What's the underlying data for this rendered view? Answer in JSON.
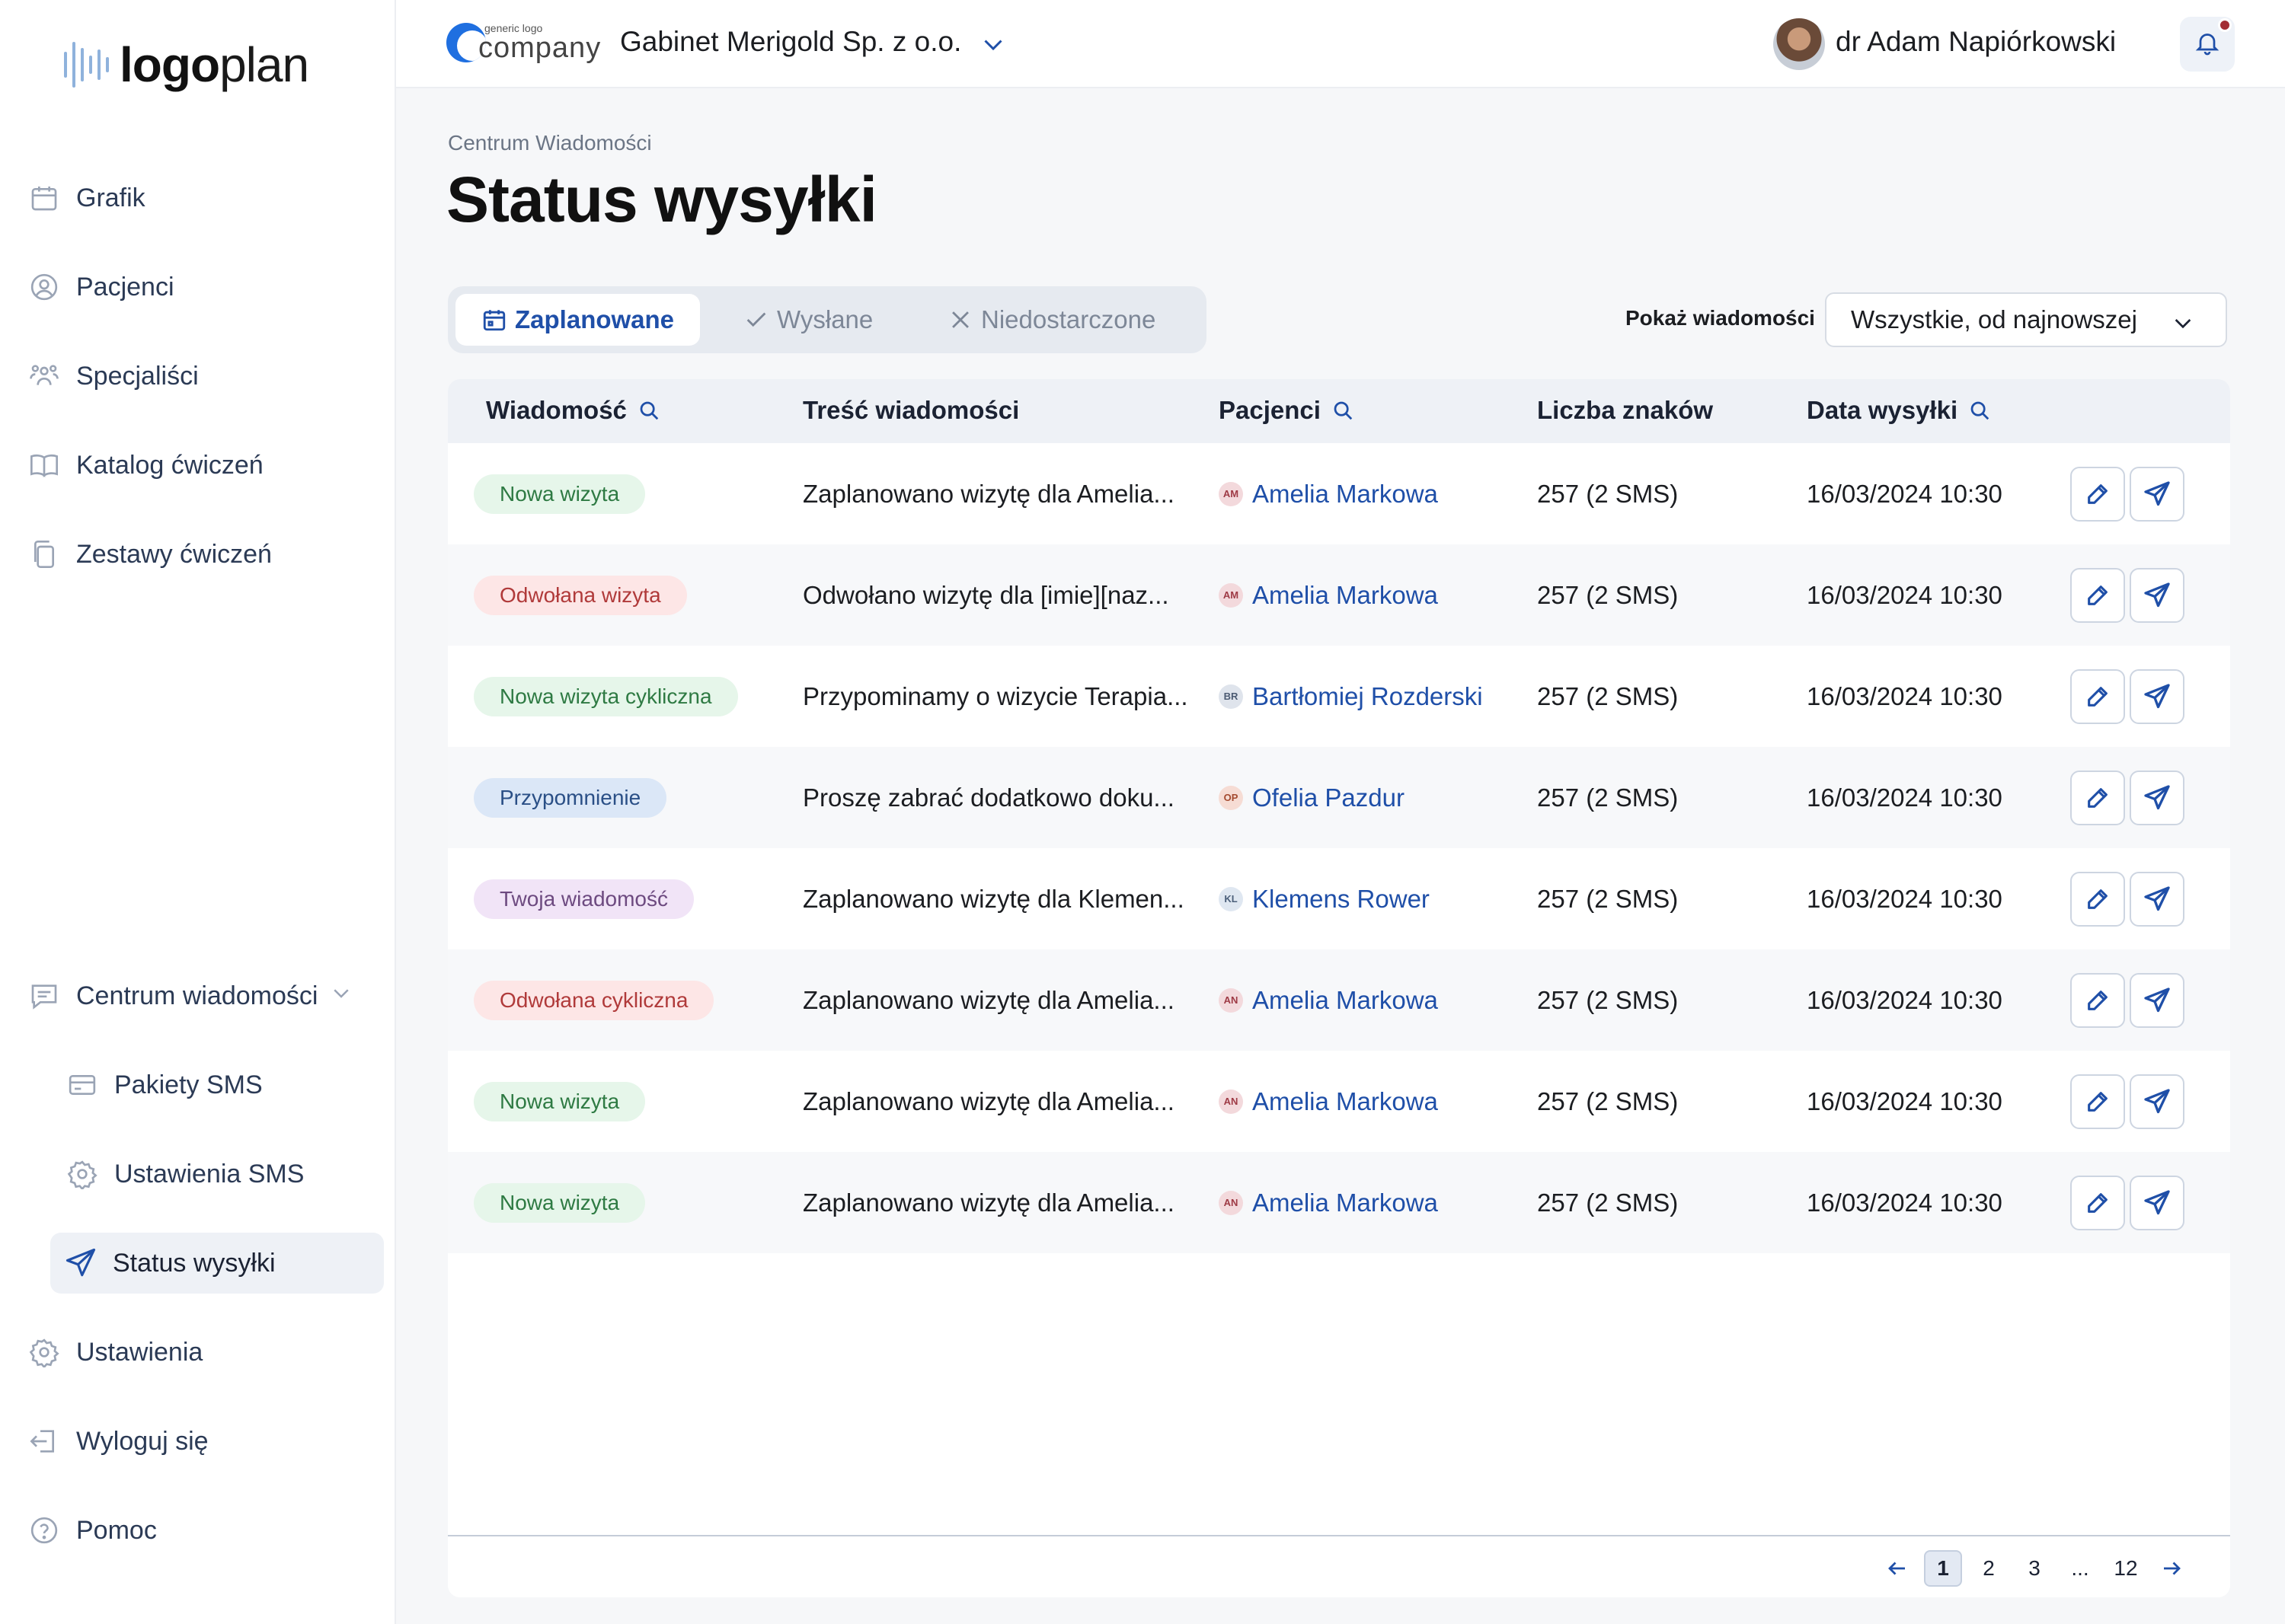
{
  "brand": {
    "logo_bold": "logo",
    "logo_light": "plan",
    "accent": "#1f4fa8"
  },
  "company": {
    "logo_small": "generic logo",
    "logo_big": "company",
    "clinic_name": "Gabinet Merigold Sp. z o.o."
  },
  "user": {
    "name": "dr Adam Napiórkowski"
  },
  "sidebar": {
    "items": [
      {
        "label": "Grafik",
        "icon": "calendar-icon"
      },
      {
        "label": "Pacjenci",
        "icon": "user-circle-icon"
      },
      {
        "label": "Specjaliści",
        "icon": "users-icon"
      },
      {
        "label": "Katalog ćwiczeń",
        "icon": "book-icon"
      },
      {
        "label": "Zestawy ćwiczeń",
        "icon": "copy-icon"
      }
    ],
    "messages_center": "Centrum wiadomości",
    "sub_items": [
      {
        "label": "Pakiety SMS",
        "icon": "card-icon"
      },
      {
        "label": "Ustawienia SMS",
        "icon": "gear-icon"
      },
      {
        "label": "Status wysyłki",
        "icon": "send-icon"
      }
    ],
    "bottom_items": [
      {
        "label": "Ustawienia",
        "icon": "gear-icon"
      },
      {
        "label": "Wyloguj się",
        "icon": "logout-icon"
      },
      {
        "label": "Pomoc",
        "icon": "help-icon"
      }
    ]
  },
  "page": {
    "breadcrumb": "Centrum Wiadomości",
    "title": "Status wysyłki"
  },
  "tabs": [
    {
      "label": "Zaplanowane",
      "active": true
    },
    {
      "label": "Wysłane",
      "active": false
    },
    {
      "label": "Niedostarczone",
      "active": false
    }
  ],
  "filter": {
    "label": "Pokaż wiadomości",
    "value": "Wszystkie, od najnowszej"
  },
  "table": {
    "headers": [
      "Wiadomość",
      "Treść wiadomości",
      "Pacjenci",
      "Liczba znaków",
      "Data wysyłki"
    ],
    "rows": [
      {
        "type": "Nowa wizyta",
        "badge_bg": "#e6f6ea",
        "badge_fg": "#2e7a43",
        "content": "Zaplanowano wizytę dla Amelia...",
        "initials": "AM",
        "init_bg": "#f3d9dc",
        "init_fg": "#9e3a45",
        "patient": "Amelia Markowa",
        "chars": "257 (2 SMS)",
        "date": "16/03/2024 10:30"
      },
      {
        "type": "Odwołana wizyta",
        "badge_bg": "#fde6e6",
        "badge_fg": "#b03a3a",
        "content": "Odwołano wizytę dla [imie][naz...",
        "initials": "AM",
        "init_bg": "#f3d9dc",
        "init_fg": "#9e3a45",
        "patient": "Amelia Markowa",
        "chars": "257 (2 SMS)",
        "date": "16/03/2024 10:30"
      },
      {
        "type": "Nowa wizyta cykliczna",
        "badge_bg": "#e6f6ea",
        "badge_fg": "#2e7a43",
        "content": "Przypominamy o wizycie Terapia...",
        "initials": "BR",
        "init_bg": "#dfe4ec",
        "init_fg": "#4b5a72",
        "patient": "Bartłomiej Rozderski",
        "chars": "257 (2 SMS)",
        "date": "16/03/2024 10:30"
      },
      {
        "type": "Przypomnienie",
        "badge_bg": "#dbe7f7",
        "badge_fg": "#2a4f86",
        "content": "Proszę zabrać dodatkowo doku...",
        "initials": "OP",
        "init_bg": "#f6dcd4",
        "init_fg": "#a44a2f",
        "patient": "Ofelia Pazdur",
        "chars": "257 (2 SMS)",
        "date": "16/03/2024 10:30"
      },
      {
        "type": "Twoja wiadomość",
        "badge_bg": "#f1e4f7",
        "badge_fg": "#6d4a80",
        "content": "Zaplanowano wizytę dla Klemen...",
        "initials": "KL",
        "init_bg": "#dfe7f1",
        "init_fg": "#4b5f7a",
        "patient": "Klemens Rower",
        "chars": "257 (2 SMS)",
        "date": "16/03/2024 10:30"
      },
      {
        "type": "Odwołana cykliczna",
        "badge_bg": "#fde6e6",
        "badge_fg": "#b03a3a",
        "content": "Zaplanowano wizytę dla Amelia...",
        "initials": "AN",
        "init_bg": "#f3d9dc",
        "init_fg": "#9e3a45",
        "patient": "Amelia Markowa",
        "chars": "257 (2 SMS)",
        "date": "16/03/2024 10:30"
      },
      {
        "type": "Nowa wizyta",
        "badge_bg": "#e6f6ea",
        "badge_fg": "#2e7a43",
        "content": "Zaplanowano wizytę dla Amelia...",
        "initials": "AN",
        "init_bg": "#f3d9dc",
        "init_fg": "#9e3a45",
        "patient": "Amelia Markowa",
        "chars": "257 (2 SMS)",
        "date": "16/03/2024 10:30"
      },
      {
        "type": "Nowa wizyta",
        "badge_bg": "#e6f6ea",
        "badge_fg": "#2e7a43",
        "content": "Zaplanowano wizytę dla Amelia...",
        "initials": "AN",
        "init_bg": "#f3d9dc",
        "init_fg": "#9e3a45",
        "patient": "Amelia Markowa",
        "chars": "257 (2 SMS)",
        "date": "16/03/2024 10:30"
      }
    ]
  },
  "pagination": {
    "pages": [
      "1",
      "2",
      "3",
      "...",
      "12"
    ],
    "current": "1"
  }
}
